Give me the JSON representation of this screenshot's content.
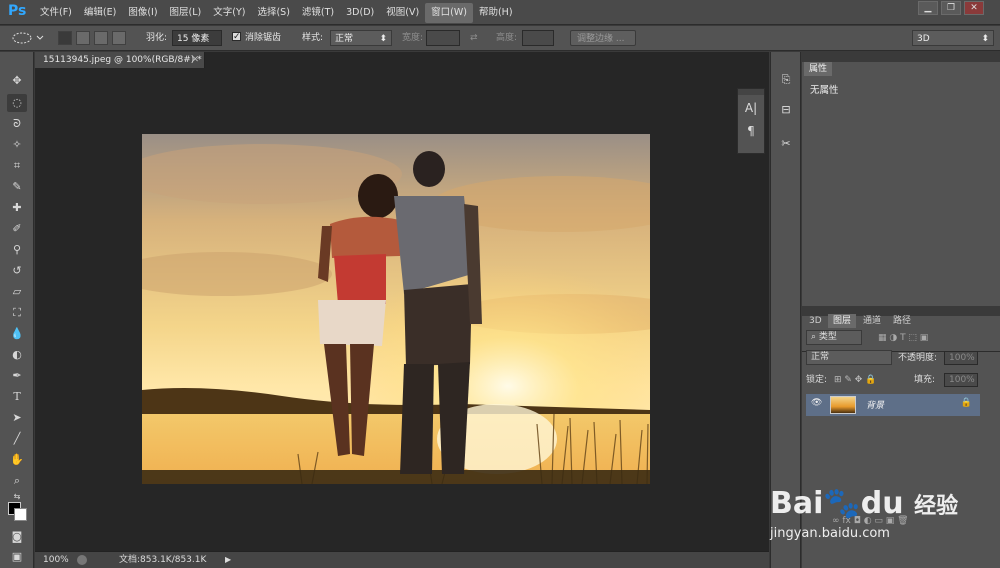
{
  "app": {
    "logo": "Ps"
  },
  "menu": {
    "items": [
      "文件(F)",
      "编辑(E)",
      "图像(I)",
      "图层(L)",
      "文字(Y)",
      "选择(S)",
      "滤镜(T)",
      "3D(D)",
      "视图(V)",
      "窗口(W)",
      "帮助(H)"
    ],
    "active_index": 9
  },
  "window_controls": {
    "minimize": "▁",
    "restore": "❐",
    "close": "✕"
  },
  "options": {
    "feather_label": "羽化:",
    "feather_value": "15 像素",
    "antialias_label": "消除锯齿",
    "antialias_checked": true,
    "style_label": "样式:",
    "style_value": "正常",
    "width_label": "宽度:",
    "height_label": "高度:",
    "refine_button": "调整边缘 ...",
    "workspace_value": "3D"
  },
  "document": {
    "tab_title": "15113945.jpeg @ 100%(RGB/8#) *",
    "zoom": "100%",
    "doc_info": "文档:853.1K/853.1K"
  },
  "panels": {
    "properties_tab": "属性",
    "properties_empty": "无属性",
    "layer_tabs": [
      "3D",
      "图层",
      "通道",
      "路径"
    ],
    "active_layer_tab": 1,
    "filter_kind": "类型",
    "blend_mode": "正常",
    "opacity_label": "不透明度:",
    "opacity_value": "100%",
    "lock_label": "锁定:",
    "fill_label": "填充:",
    "fill_value": "100%",
    "layers": [
      {
        "name": "背景",
        "locked": true
      }
    ]
  },
  "watermark": {
    "brand": "Bai",
    "brand2": "du",
    "cn": "经验",
    "url": "jingyan.baidu.com"
  },
  "colors": {
    "accent": "#31a8ff",
    "selected_layer": "#5e6f88",
    "window_bg": "#535353",
    "canvas_bg": "#262626"
  }
}
